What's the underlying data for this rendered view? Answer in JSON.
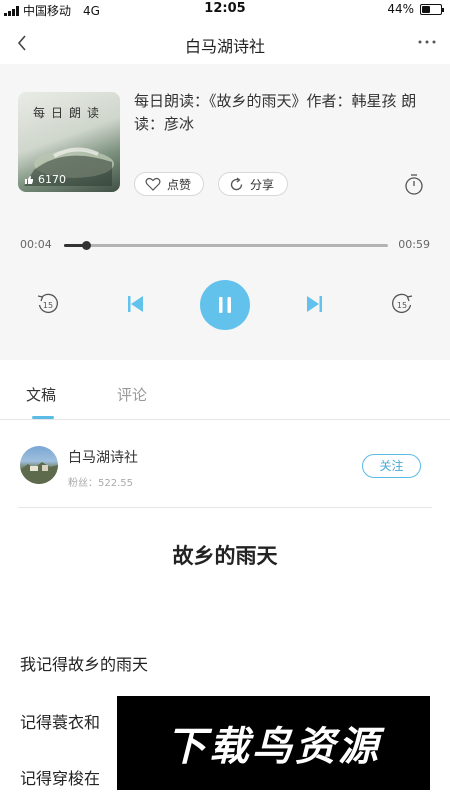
{
  "status_bar": {
    "carrier": "中国移动",
    "network": "4G",
    "time": "12:05",
    "battery_label": "44%",
    "battery_level": 0.44
  },
  "header": {
    "title": "白马湖诗社",
    "back_icon": "chevron-left-icon",
    "more_icon": "more-horizontal-icon"
  },
  "player": {
    "cover_title": "每日朗读",
    "cover_count": "6170",
    "track_title": "每日朗读：《故乡的雨天》作者：韩星孩 朗读：彦冰",
    "like_label": "点赞",
    "share_label": "分享",
    "current_time": "00:04",
    "total_time": "00:59",
    "progress": 0.068,
    "rewind_seconds": "15",
    "forward_seconds": "15",
    "accent_color": "#62c2ec"
  },
  "tabs": [
    {
      "label": "文稿",
      "active": true
    },
    {
      "label": "评论",
      "active": false
    }
  ],
  "author": {
    "name": "白马湖诗社",
    "fans": "粉丝：522.55",
    "follow_label": "关注"
  },
  "article": {
    "title": "故乡的雨天",
    "lines": [
      "我记得故乡的雨天",
      "记得蓑衣和",
      "记得穿梭在"
    ]
  },
  "watermark": "下载鸟资源"
}
